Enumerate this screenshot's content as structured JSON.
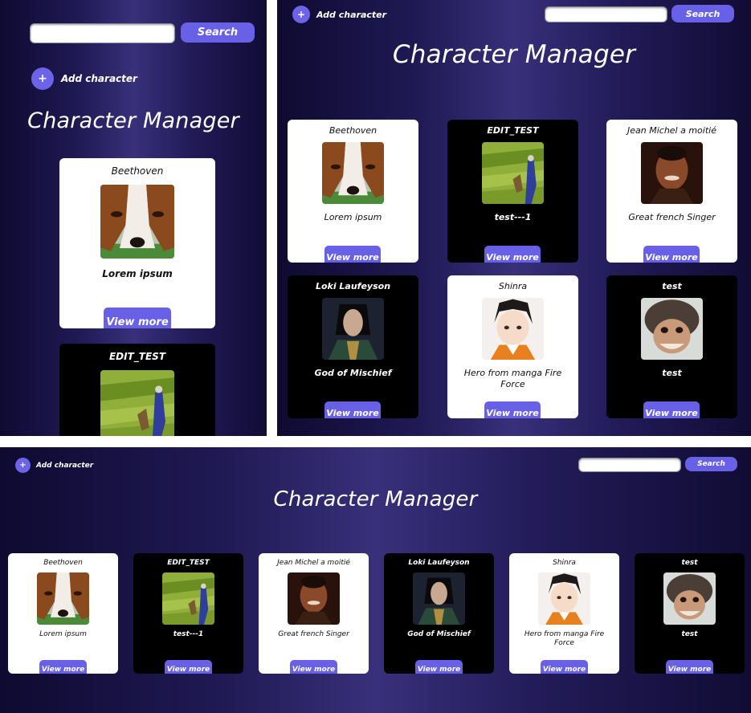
{
  "app": {
    "title": "Character Manager",
    "search_button": "Search",
    "search_placeholder": "",
    "search_value": "",
    "add_label": "Add character",
    "view_more_label": "View more"
  },
  "colors": {
    "accent": "#6860e6",
    "background_dark": "#100c34",
    "background_mid": "#38307a",
    "card_light": "#ffffff",
    "card_dark": "#000000"
  },
  "characters": [
    {
      "name": "Beethoven",
      "description": "Lorem ipsum",
      "theme": "light",
      "image": "saint-bernard-dog-photo"
    },
    {
      "name": "EDIT_TEST",
      "description": "test---1",
      "theme": "dark",
      "image": "farmer-in-field-photo"
    },
    {
      "name": "Jean Michel a moitié",
      "description": "Great french Singer",
      "theme": "light",
      "image": "singer-portrait-photo"
    },
    {
      "name": "Loki Laufeyson",
      "description": "God of Mischief",
      "theme": "dark",
      "image": "loki-portrait-photo"
    },
    {
      "name": "Shinra",
      "description": "Hero from manga Fire Force",
      "theme": "light",
      "image": "anime-character-portrait"
    },
    {
      "name": "test",
      "description": "test",
      "theme": "dark",
      "image": "troll-doll-photo"
    }
  ]
}
